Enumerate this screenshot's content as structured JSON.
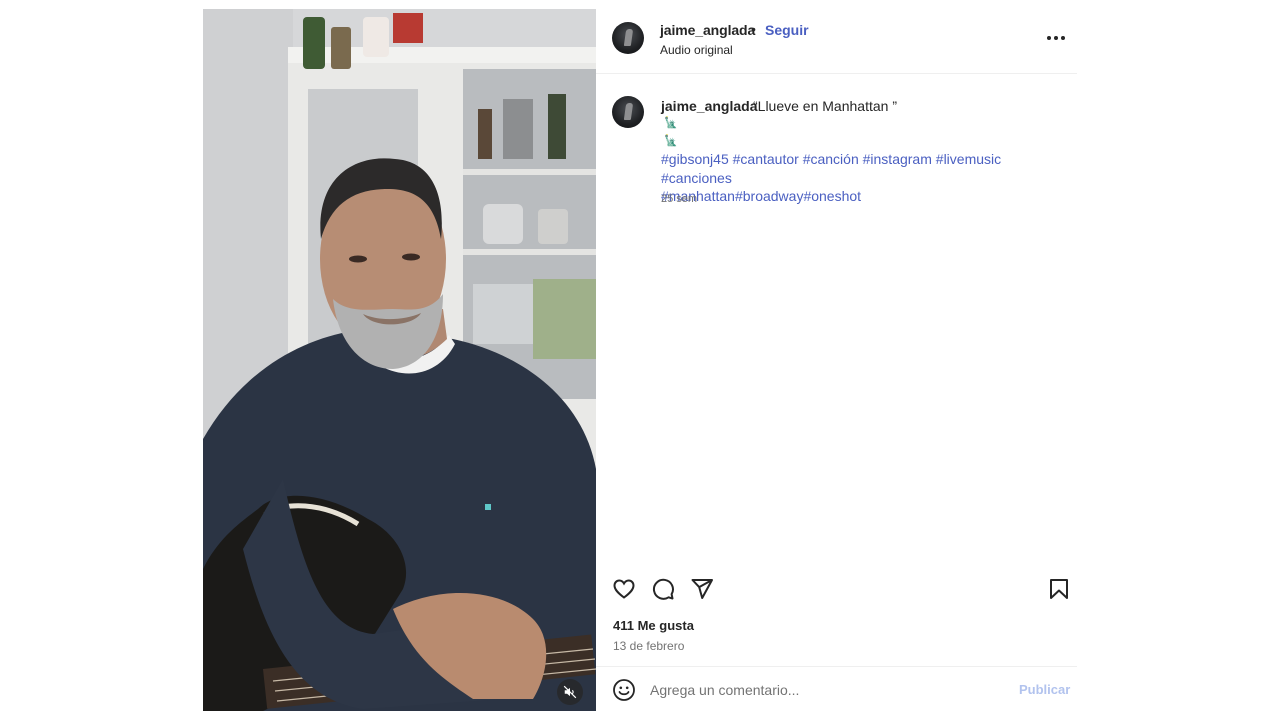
{
  "post": {
    "media": {
      "mute_icon": "speaker-muted-icon"
    },
    "header": {
      "username": "jaime_anglada",
      "separator": "•",
      "follow_label": "Seguir",
      "audio_label": "Audio original",
      "more_icon": "more-options-icon"
    },
    "caption": {
      "username": "jaime_anglada",
      "title": "“Llueve en Manhattan ”",
      "emoji_lines": [
        "🗽",
        "🗽"
      ],
      "hashtags": [
        "#gibsonj45",
        "#cantautor",
        "#canción",
        "#instagram",
        "#livemusic",
        "#canciones",
        "#manhattan",
        "#broadway",
        "#oneshot"
      ],
      "time_ago": "25 sem"
    },
    "actions": {
      "like_icon": "heart-icon",
      "comment_icon": "comment-icon",
      "share_icon": "send-icon",
      "save_icon": "bookmark-icon"
    },
    "likes_text": "411 Me gusta",
    "date": "13 de febrero",
    "comment_box": {
      "emoji_icon": "smiley-icon",
      "placeholder": "Agrega un comentario...",
      "publish_label": "Publicar"
    },
    "colors": {
      "link_blue": "#4a5fc1",
      "publish_disabled": "#b2c3ee",
      "muted_text": "#737373",
      "divider": "#efefef"
    }
  }
}
